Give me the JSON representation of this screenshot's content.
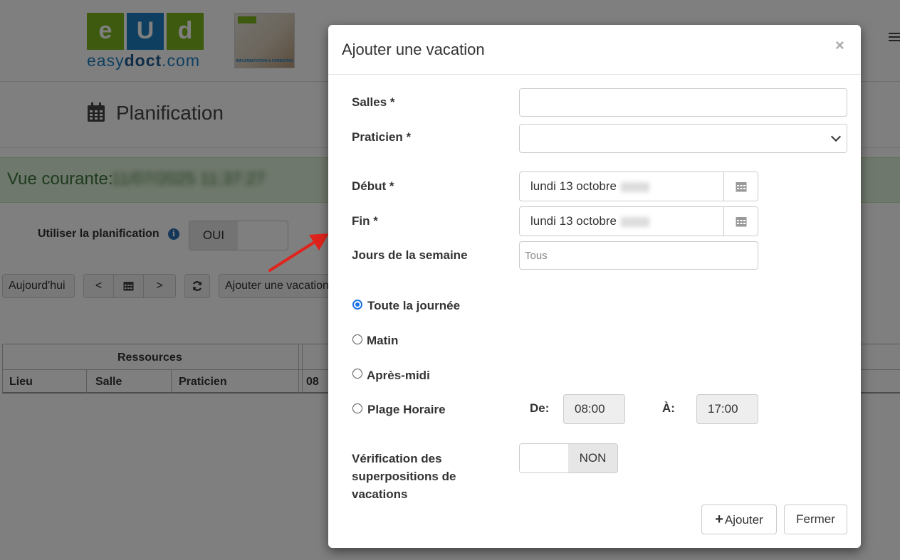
{
  "header": {
    "logo_letters": [
      "e",
      "U",
      "d"
    ],
    "logo_text_light": "easy",
    "logo_text_bold": "doct",
    "logo_text_suffix": ".com",
    "partner_caption": "IMPLEMENTATION & FORMATION"
  },
  "page": {
    "title": "Planification",
    "current_view_label": "Vue courante:",
    "current_view_value": "11/07/2025 11:37:27",
    "use_planning_label": "Utiliser la planification",
    "use_planning_toggle": "OUI",
    "buttons": {
      "today": "Aujourd'hui",
      "prev": "<",
      "next": ">",
      "add_vacation": "Ajouter une vacation"
    },
    "table": {
      "group_header": "Ressources",
      "columns": [
        "Lieu",
        "Salle",
        "Praticien"
      ],
      "first_hour": "08"
    }
  },
  "modal": {
    "title": "Ajouter une vacation",
    "close": "×",
    "fields": {
      "salles_label": "Salles *",
      "salles_value": "",
      "praticien_label": "Praticien *",
      "praticien_value": "",
      "debut_label": "Début *",
      "debut_value": "lundi 13 octobre",
      "fin_label": "Fin *",
      "fin_value": "lundi 13 octobre",
      "jours_label": "Jours de la semaine",
      "jours_placeholder": "Tous"
    },
    "radios": [
      {
        "label": "Toute la journée",
        "checked": true
      },
      {
        "label": "Matin",
        "checked": false
      },
      {
        "label": "Après-midi",
        "checked": false
      },
      {
        "label": "Plage Horaire",
        "checked": false
      }
    ],
    "time_range": {
      "from_label": "De:",
      "from_value": "08:00",
      "to_label": "À:",
      "to_value": "17:00"
    },
    "overlap_check": {
      "label_line1": "Vérification des",
      "label_line2": "superpositions de",
      "label_line3": "vacations",
      "toggle": "NON"
    },
    "actions": {
      "add_plus": "+",
      "add": "Ajouter",
      "close": "Fermer"
    }
  },
  "colors": {
    "brand_green": "#7ab51d",
    "brand_blue": "#1d7fc0",
    "alert_bg": "#dff0d8",
    "alert_text": "#3c763d",
    "radio_checked": "#1a73e8",
    "arrow": "#e0231c"
  },
  "icons": [
    "calendar-icon",
    "info-icon",
    "refresh-icon",
    "close-icon",
    "chevron-down-icon",
    "plus-icon",
    "hamburger-icon"
  ]
}
